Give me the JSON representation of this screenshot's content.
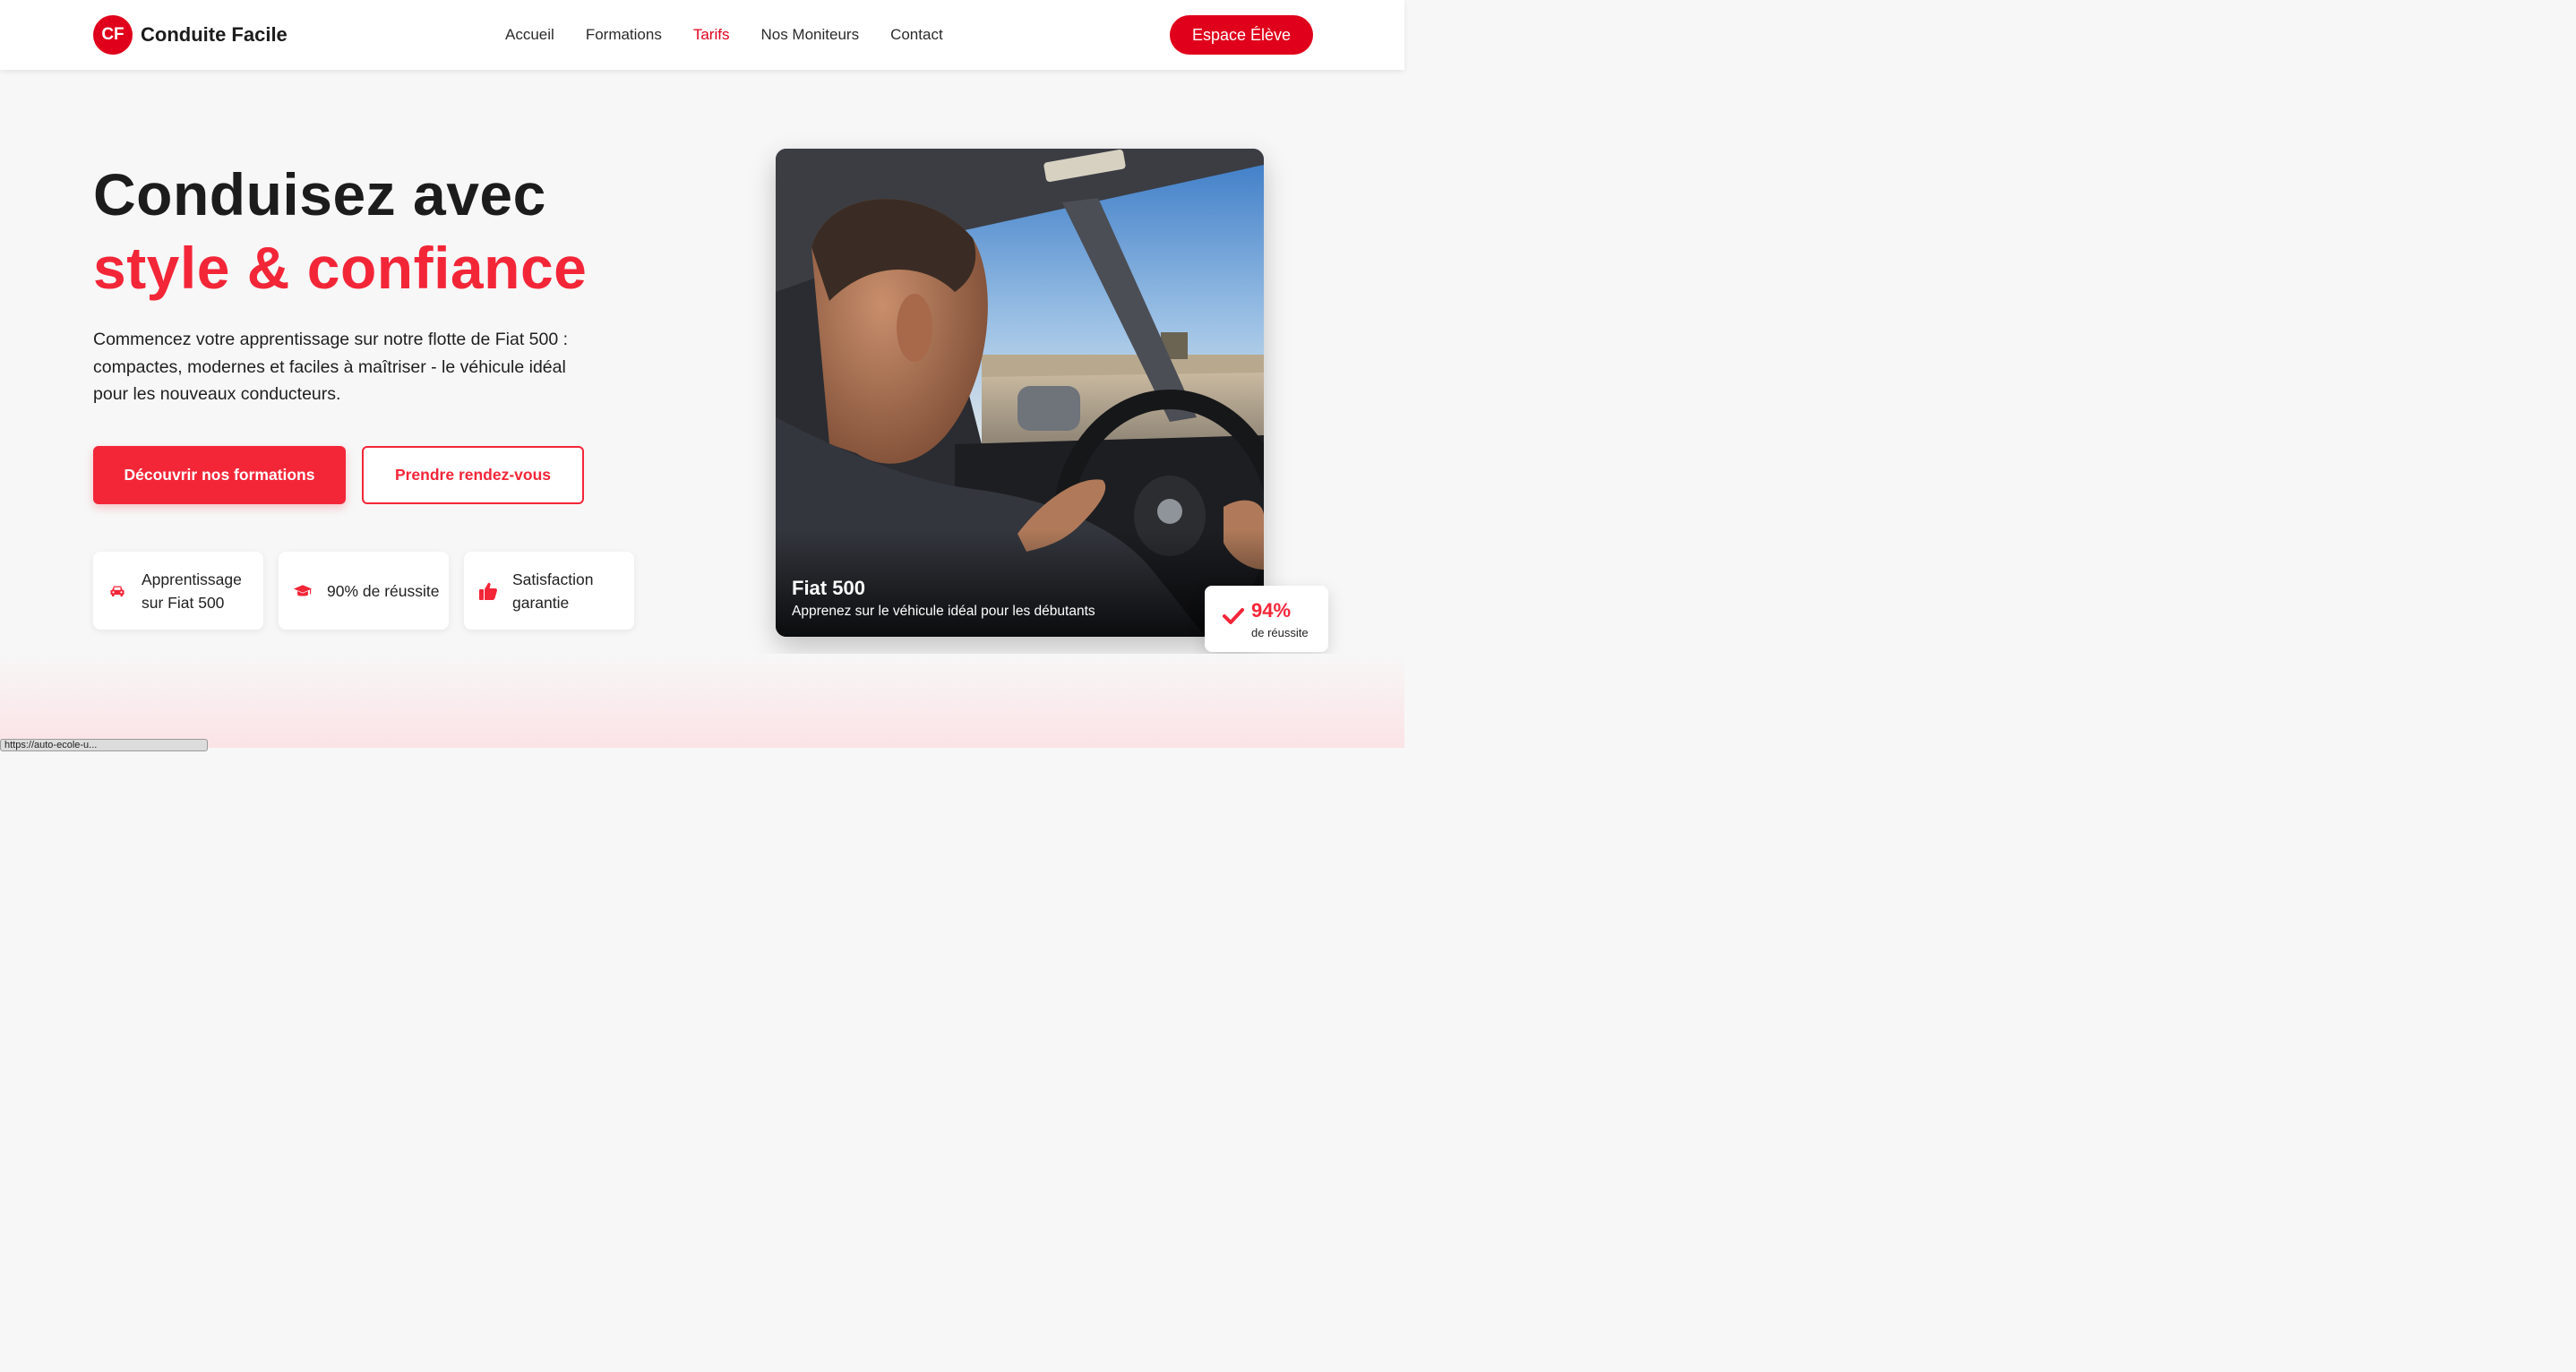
{
  "header": {
    "logo_badge": "CF",
    "brand_name": "Conduite Facile",
    "nav": [
      "Accueil",
      "Formations",
      "Tarifs",
      "Nos Moniteurs",
      "Contact"
    ],
    "active_nav": "Tarifs",
    "student_button": "Espace Élève"
  },
  "hero": {
    "title_line1": "Conduisez avec",
    "title_line2": "style & confiance",
    "description": "Commencez votre apprentissage sur notre flotte de Fiat 500 : compactes, modernes et faciles à maîtriser - le véhicule idéal pour les nouveaux conducteurs.",
    "primary_button": "Découvrir nos formations",
    "secondary_button": "Prendre rendez-vous",
    "features": [
      {
        "icon": "car-icon",
        "label": "Apprentissage sur Fiat 500"
      },
      {
        "icon": "graduation-cap-icon",
        "label": "90% de réussite"
      },
      {
        "icon": "thumbs-up-icon",
        "label": "Satisfaction garantie"
      }
    ]
  },
  "photo": {
    "title": "Fiat 500",
    "subtitle": "Apprenez sur le véhicule idéal pour les débutants"
  },
  "success_badge": {
    "value": "94%",
    "label": "de réussite"
  },
  "status_bar": {
    "url": "https://auto-ecole-u..."
  },
  "colors": {
    "brand_red": "#e0001b",
    "accent_red": "#f32638"
  }
}
